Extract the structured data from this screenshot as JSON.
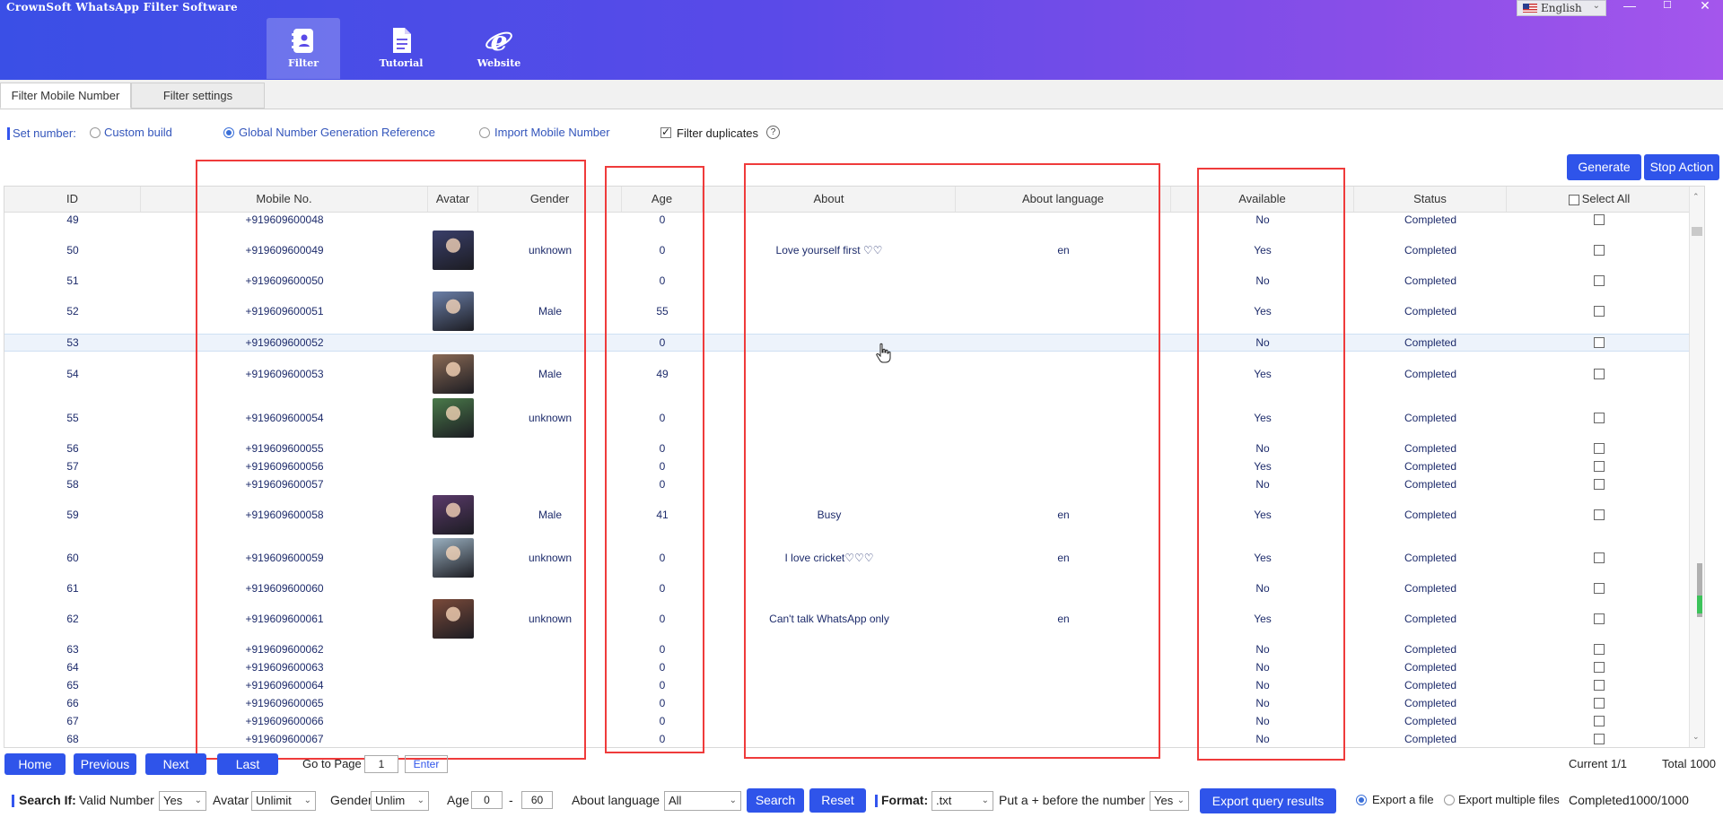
{
  "app": {
    "title": "CrownSoft WhatsApp Filter Software"
  },
  "nav": [
    {
      "label": "Filter",
      "icon": "contact-book-icon"
    },
    {
      "label": "Tutorial",
      "icon": "document-icon"
    },
    {
      "label": "Website",
      "icon": "internet-explorer-icon"
    }
  ],
  "language": {
    "value": "English"
  },
  "window": {
    "minimize": "—",
    "maximize": "☐",
    "close": "✕"
  },
  "tabs": [
    "Filter Mobile Number",
    "Filter settings"
  ],
  "set_number": {
    "label": "Set number:",
    "options": [
      "Custom build",
      "Global Number Generation Reference",
      "Import Mobile Number"
    ],
    "selected": "Global Number Generation Reference",
    "filter_duplicates": "Filter duplicates",
    "help": "?"
  },
  "actions": {
    "generate": "Generate",
    "stop": "Stop Action"
  },
  "columns": {
    "id": "ID",
    "mobile": "Mobile No.",
    "avatar": "Avatar",
    "gender": "Gender",
    "age": "Age",
    "about": "About",
    "about_language": "About language",
    "available": "Available",
    "status": "Status",
    "select_all": "Select All"
  },
  "rows": [
    {
      "id": "49",
      "mobile": "+919609600048",
      "avatar": false,
      "gender": "",
      "age": "0",
      "about": "",
      "lang": "",
      "available": "No",
      "status": "Completed",
      "h": 18
    },
    {
      "id": "50",
      "mobile": "+919609600049",
      "avatar": true,
      "avatar_color": "#3a3f6a",
      "gender": "unknown",
      "age": "0",
      "about": "Love yourself first ♡♡",
      "lang": "en",
      "available": "Yes",
      "status": "Completed",
      "h": 50
    },
    {
      "id": "51",
      "mobile": "+919609600050",
      "avatar": false,
      "gender": "",
      "age": "0",
      "about": "",
      "lang": "",
      "available": "No",
      "status": "Completed",
      "h": 18
    },
    {
      "id": "52",
      "mobile": "+919609600051",
      "avatar": true,
      "avatar_color": "#6b7fa8",
      "gender": "Male",
      "age": "55",
      "about": "",
      "lang": "",
      "available": "Yes",
      "status": "Completed",
      "h": 50
    },
    {
      "id": "53",
      "mobile": "+919609600052",
      "avatar": false,
      "gender": "",
      "age": "0",
      "about": "",
      "lang": "",
      "available": "No",
      "status": "Completed",
      "h": 20,
      "selected": true
    },
    {
      "id": "54",
      "mobile": "+919609600053",
      "avatar": true,
      "avatar_color": "#8a6a55",
      "gender": "Male",
      "age": "49",
      "about": "",
      "lang": "",
      "available": "Yes",
      "status": "Completed",
      "h": 50
    },
    {
      "id": "55",
      "mobile": "+919609600054",
      "avatar": true,
      "avatar_color": "#4a7a4a",
      "gender": "unknown",
      "age": "0",
      "about": "",
      "lang": "",
      "available": "Yes",
      "status": "Completed",
      "h": 48
    },
    {
      "id": "56",
      "mobile": "+919609600055",
      "avatar": false,
      "gender": "",
      "age": "0",
      "about": "",
      "lang": "",
      "available": "No",
      "status": "Completed",
      "h": 20
    },
    {
      "id": "57",
      "mobile": "+919609600056",
      "avatar": false,
      "gender": "",
      "age": "0",
      "about": "",
      "lang": "",
      "available": "Yes",
      "status": "Completed",
      "h": 20
    },
    {
      "id": "58",
      "mobile": "+919609600057",
      "avatar": false,
      "gender": "",
      "age": "0",
      "about": "",
      "lang": "",
      "available": "No",
      "status": "Completed",
      "h": 20
    },
    {
      "id": "59",
      "mobile": "+919609600058",
      "avatar": true,
      "avatar_color": "#5a3a6a",
      "gender": "Male",
      "age": "41",
      "about": "Busy",
      "lang": "en",
      "available": "Yes",
      "status": "Completed",
      "h": 48
    },
    {
      "id": "60",
      "mobile": "+919609600059",
      "avatar": true,
      "avatar_color": "#9ab0c0",
      "gender": "unknown",
      "age": "0",
      "about": "I love cricket♡♡♡",
      "lang": "en",
      "available": "Yes",
      "status": "Completed",
      "h": 48
    },
    {
      "id": "61",
      "mobile": "+919609600060",
      "avatar": false,
      "gender": "",
      "age": "0",
      "about": "",
      "lang": "",
      "available": "No",
      "status": "Completed",
      "h": 20
    },
    {
      "id": "62",
      "mobile": "+919609600061",
      "avatar": true,
      "avatar_color": "#7a4a3a",
      "gender": "unknown",
      "age": "0",
      "about": "Can't talk WhatsApp only",
      "lang": "en",
      "available": "Yes",
      "status": "Completed",
      "h": 48
    },
    {
      "id": "63",
      "mobile": "+919609600062",
      "avatar": false,
      "gender": "",
      "age": "0",
      "about": "",
      "lang": "",
      "available": "No",
      "status": "Completed",
      "h": 20
    },
    {
      "id": "64",
      "mobile": "+919609600063",
      "avatar": false,
      "gender": "",
      "age": "0",
      "about": "",
      "lang": "",
      "available": "No",
      "status": "Completed",
      "h": 20
    },
    {
      "id": "65",
      "mobile": "+919609600064",
      "avatar": false,
      "gender": "",
      "age": "0",
      "about": "",
      "lang": "",
      "available": "No",
      "status": "Completed",
      "h": 20
    },
    {
      "id": "66",
      "mobile": "+919609600065",
      "avatar": false,
      "gender": "",
      "age": "0",
      "about": "",
      "lang": "",
      "available": "No",
      "status": "Completed",
      "h": 20
    },
    {
      "id": "67",
      "mobile": "+919609600066",
      "avatar": false,
      "gender": "",
      "age": "0",
      "about": "",
      "lang": "",
      "available": "No",
      "status": "Completed",
      "h": 20
    },
    {
      "id": "68",
      "mobile": "+919609600067",
      "avatar": false,
      "gender": "",
      "age": "0",
      "about": "",
      "lang": "",
      "available": "No",
      "status": "Completed",
      "h": 20
    }
  ],
  "pager": {
    "home": "Home",
    "previous": "Previous",
    "next": "Next",
    "last": "Last",
    "goto": "Go to Page",
    "page": "1",
    "enter": "Enter",
    "current": "Current 1/1",
    "total": "Total 1000"
  },
  "search": {
    "label": "Search If:",
    "valid_number_label": "Valid Number",
    "valid_number": "Yes",
    "avatar_label": "Avatar",
    "avatar": "Unlimit",
    "gender_label": "Gender",
    "gender": "Unlim",
    "age_label": "Age",
    "age_min": "0",
    "age_sep": "-",
    "age_max": "60",
    "about_language_label": "About language",
    "about_language": "All",
    "search": "Search",
    "reset": "Reset"
  },
  "export": {
    "format_label": "Format:",
    "format": ".txt",
    "plus_label": "Put a + before the number",
    "plus": "Yes",
    "export_button": "Export query results",
    "export_file": "Export a file",
    "export_multiple": "Export multiple files",
    "progress": "Completed1000/1000"
  },
  "colors": {
    "accent": "#2f54ea",
    "highlight": "#ef3b3b"
  }
}
